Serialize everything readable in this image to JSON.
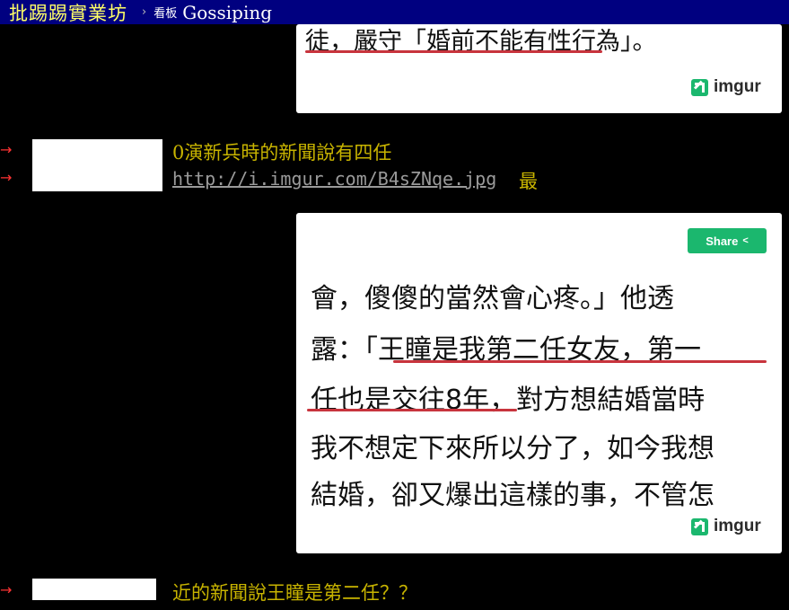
{
  "header": {
    "site_name": "批踢踢實業坊",
    "separator": "›",
    "board_label": "看板",
    "board_name": "Gossiping"
  },
  "image1": {
    "caption": "徒，嚴守「婚前不能有性行為」。",
    "watermark": "imgur"
  },
  "comments": [
    {
      "arrow": "→",
      "text": "0演新兵時的新聞說有四任"
    },
    {
      "arrow": "→",
      "link": "http://i.imgur.com/B4sZNqe.jpg",
      "trailing": "最"
    },
    {
      "arrow": "→",
      "text": "近的新聞說王瞳是第二任？？"
    }
  ],
  "image2": {
    "share_label": "Share",
    "lines": [
      "會，傻傻的當然會心疼。」他透",
      "露：「王瞳是我第二任女友，第一",
      "任也是交往8年，對方想結婚當時",
      "我不想定下來所以分了，如今我想",
      "結婚，卻又爆出這樣的事，不管怎"
    ],
    "watermark": "imgur"
  },
  "colors": {
    "nav_bg": "#000080",
    "site_name": "#ffff66",
    "push_arrow": "#ff3333",
    "push_text": "#c8b400",
    "imgur_green": "#1bb76e",
    "underline_red": "#c8343d"
  }
}
